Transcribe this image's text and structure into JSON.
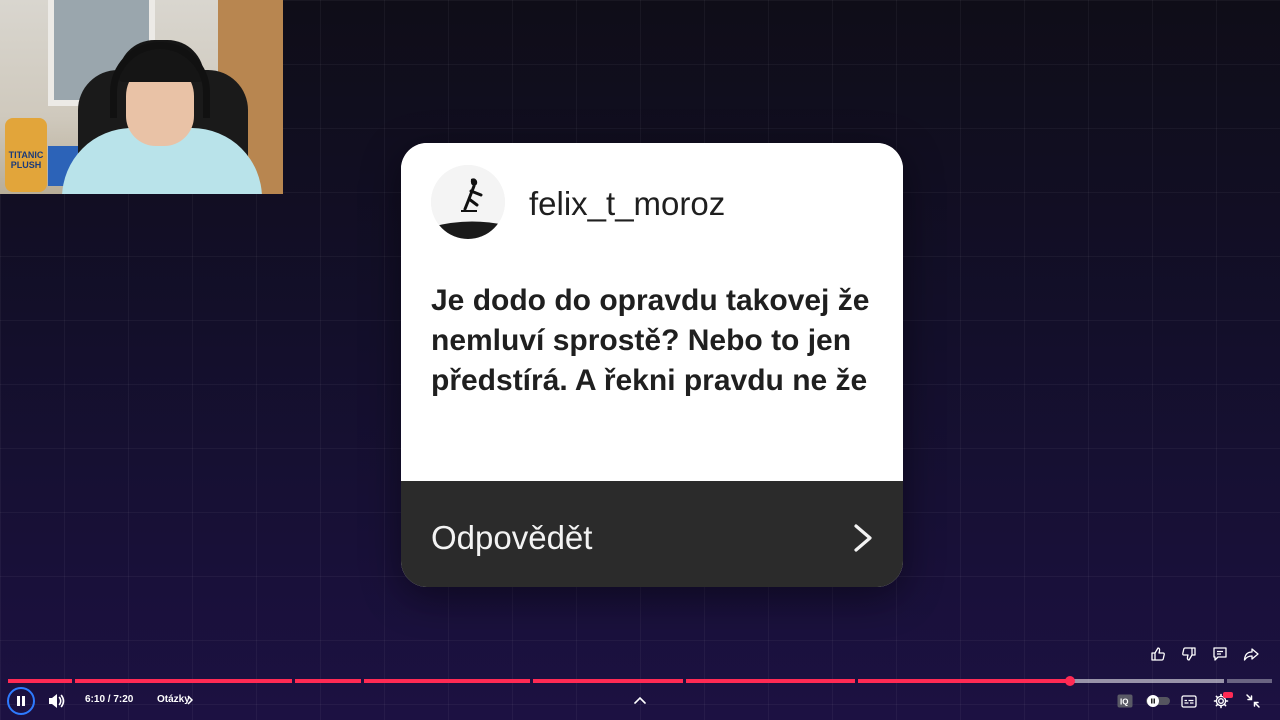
{
  "card": {
    "username": "felix_t_moroz",
    "question": "Je dodo do opravdu takovej že nemluví sprostě? Nebo to jen předstírá. A řekni pravdu ne že",
    "reply_label": "Odpovědět"
  },
  "webcam": {
    "plush_text": "TITANIC PLUSH"
  },
  "player": {
    "time": "6:10 / 7:20",
    "chapter": "Otázky",
    "progress_fraction": 0.843,
    "accent_color": "#ff2a54",
    "play_ring_color": "#2e7bff"
  },
  "icons": {
    "pause": "pause-icon",
    "volume": "volume-icon",
    "like": "thumbs-up-icon",
    "dislike": "thumbs-down-icon",
    "comments": "comment-icon",
    "share": "share-icon",
    "expand": "chevron-up-icon",
    "iq": "iq-icon",
    "autoplay": "autoplay-toggle-icon",
    "subtitles": "subtitles-icon",
    "settings": "gear-icon",
    "fullscreen_exit": "exit-fullscreen-icon"
  }
}
